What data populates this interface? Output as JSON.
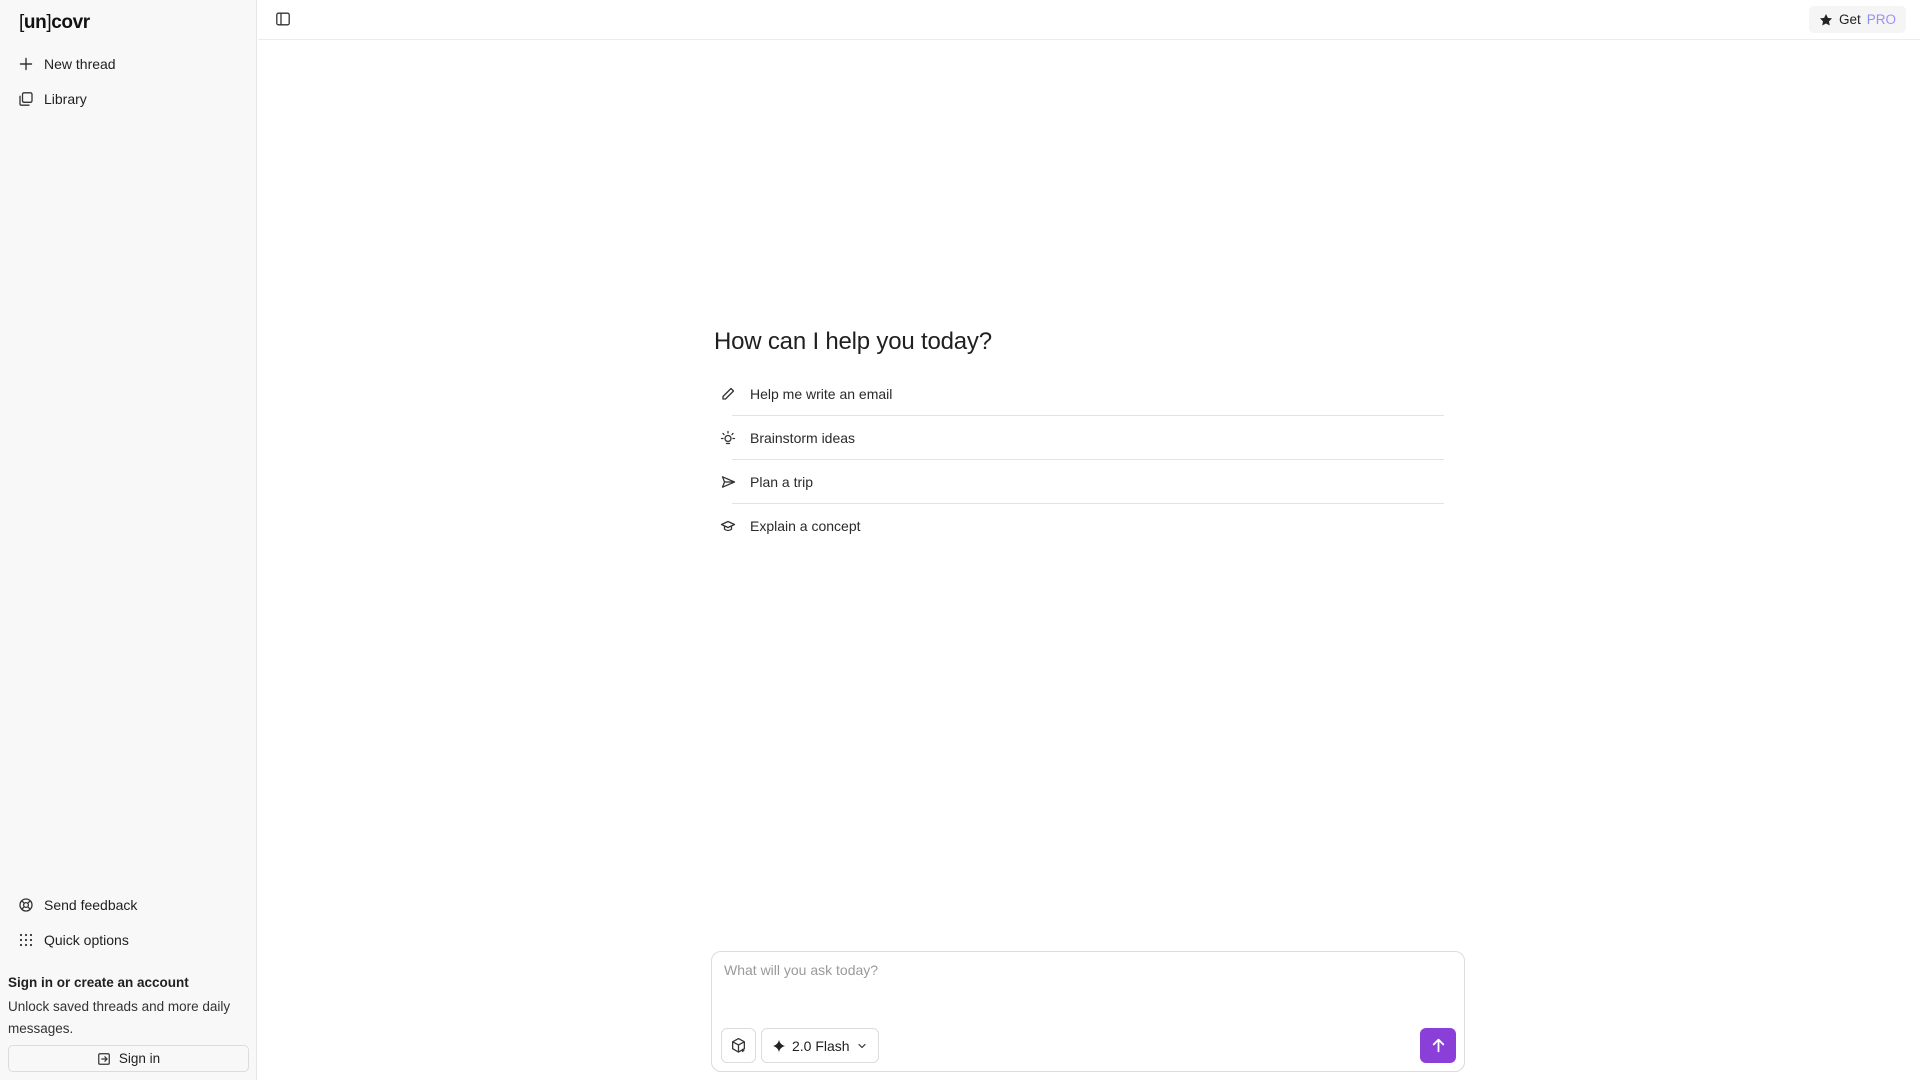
{
  "sidebar": {
    "logo": {
      "bracket_open": "[",
      "un": "un",
      "bracket_close": "]",
      "rest": "covr"
    },
    "nav": [
      {
        "label": "New thread",
        "icon": "plus-icon"
      },
      {
        "label": "Library",
        "icon": "library-icon"
      }
    ],
    "footer_nav": [
      {
        "label": "Send feedback",
        "icon": "feedback-icon"
      },
      {
        "label": "Quick options",
        "icon": "grid-icon"
      }
    ],
    "signin": {
      "title": "Sign in or create an account",
      "description": "Unlock saved threads and more daily messages.",
      "button_label": "Sign in"
    }
  },
  "topbar": {
    "toggle_icon": "sidebar-toggle-icon",
    "pro_button": {
      "prefix": "Get",
      "highlight": "PRO",
      "icon": "star-icon"
    }
  },
  "main": {
    "greeting": "How can I help you today?",
    "suggestions": [
      {
        "label": "Help me write an email",
        "icon": "pencil-icon"
      },
      {
        "label": "Brainstorm ideas",
        "icon": "lightbulb-icon"
      },
      {
        "label": "Plan a trip",
        "icon": "plane-icon"
      },
      {
        "label": "Explain a concept",
        "icon": "graduation-cap-icon"
      }
    ]
  },
  "composer": {
    "placeholder": "What will you ask today?",
    "value": "",
    "model_label": "2.0 Flash",
    "attach_icon": "box-plus-icon",
    "send_icon": "arrow-up-icon"
  },
  "colors": {
    "accent": "#8b3fd9",
    "sidebar_bg": "#f8f8f8",
    "pro_gradient_start": "#8b8ff0",
    "pro_gradient_end": "#a78bfa"
  }
}
